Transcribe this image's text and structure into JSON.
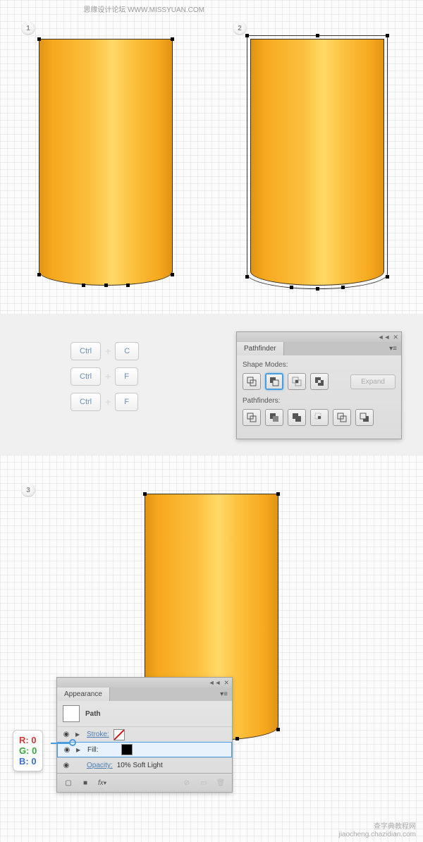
{
  "watermark": {
    "top_text": "思缘设计论坛 WWW.MISSYUAN.COM",
    "bottom_line1": "查字典教程网",
    "bottom_line2": "jiaocheng.chazidian.com"
  },
  "steps": {
    "s1": "1",
    "s2": "2",
    "s3": "3"
  },
  "shortcuts": {
    "ctrl": "Ctrl",
    "c": "C",
    "f": "F"
  },
  "pathfinder": {
    "title": "Pathfinder",
    "shape_modes": "Shape Modes:",
    "pathfinders": "Pathfinders:",
    "expand": "Expand"
  },
  "appearance": {
    "title": "Appearance",
    "path": "Path",
    "stroke": "Stroke:",
    "fill": "Fill:",
    "opacity": "Opacity:",
    "opacity_val": "10% Soft Light",
    "fx": "fx"
  },
  "rgb": {
    "r_label": "R:",
    "r_val": "0",
    "g_label": "G:",
    "g_val": "0",
    "b_label": "B:",
    "b_val": "0"
  }
}
